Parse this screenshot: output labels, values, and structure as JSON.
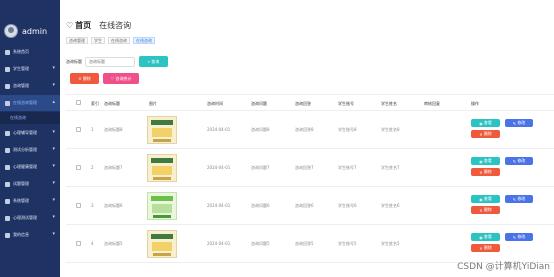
{
  "sidebar": {
    "user": "admin",
    "menu": [
      {
        "label": "系统首页",
        "active": false
      },
      {
        "label": "学生管理",
        "active": false
      },
      {
        "label": "咨询管理",
        "active": false
      },
      {
        "label": "在线咨询管理",
        "active": true
      },
      {
        "label": "心理辅导管理",
        "active": false
      },
      {
        "label": "测试分析管理",
        "active": false
      },
      {
        "label": "心理健康管理",
        "active": false
      },
      {
        "label": "试题管理",
        "active": false
      },
      {
        "label": "系统管理",
        "active": false
      },
      {
        "label": "心理测试管理",
        "active": false
      },
      {
        "label": "我的信息",
        "active": false
      }
    ],
    "submenu": {
      "label": "在线咨询"
    }
  },
  "header": {
    "home": "首页",
    "current": "在线咨询",
    "tags": [
      "咨询管理",
      "学生",
      "在线咨询",
      "在线咨询"
    ]
  },
  "search": {
    "label": "咨询标题",
    "placeholder": "咨询标题",
    "button": "查询"
  },
  "actions": {
    "delete": "删除",
    "stat": "咨询统计"
  },
  "table": {
    "headers": [
      "索引",
      "咨询标题",
      "图片",
      "咨询时间",
      "咨询问题",
      "咨询回答",
      "学生账号",
      "学生姓名",
      "审核回复",
      "操作"
    ],
    "rows": [
      {
        "index": "1",
        "title": "咨询标题8",
        "time": "2024-04-01",
        "question": "咨询问题8",
        "answer": "咨询回答8",
        "account": "学生账号8",
        "name": "学生姓名8",
        "thumb": "yellow"
      },
      {
        "index": "2",
        "title": "咨询标题7",
        "time": "2024-04-01",
        "question": "咨询问题7",
        "answer": "咨询回答7",
        "account": "学生账号7",
        "name": "学生姓名7",
        "thumb": "yellow"
      },
      {
        "index": "3",
        "title": "咨询标题6",
        "time": "2024-04-01",
        "question": "咨询问题6",
        "answer": "咨询回答6",
        "account": "学生账号6",
        "name": "学生姓名6",
        "thumb": "green"
      },
      {
        "index": "4",
        "title": "咨询标题5",
        "time": "2024-04-01",
        "question": "咨询问题5",
        "answer": "咨询回答5",
        "account": "学生账号5",
        "name": "学生姓名5",
        "thumb": "yellow"
      }
    ],
    "row_actions": {
      "detail": "查看",
      "edit": "修改",
      "delete": "删除"
    }
  },
  "watermark": "CSDN @计算机YiDian",
  "colors": {
    "sidebar": "#1f3264",
    "search": "#2bc4c2",
    "danger": "#f05a3c",
    "edit": "#4a73e8",
    "stat": "#f0508a"
  }
}
